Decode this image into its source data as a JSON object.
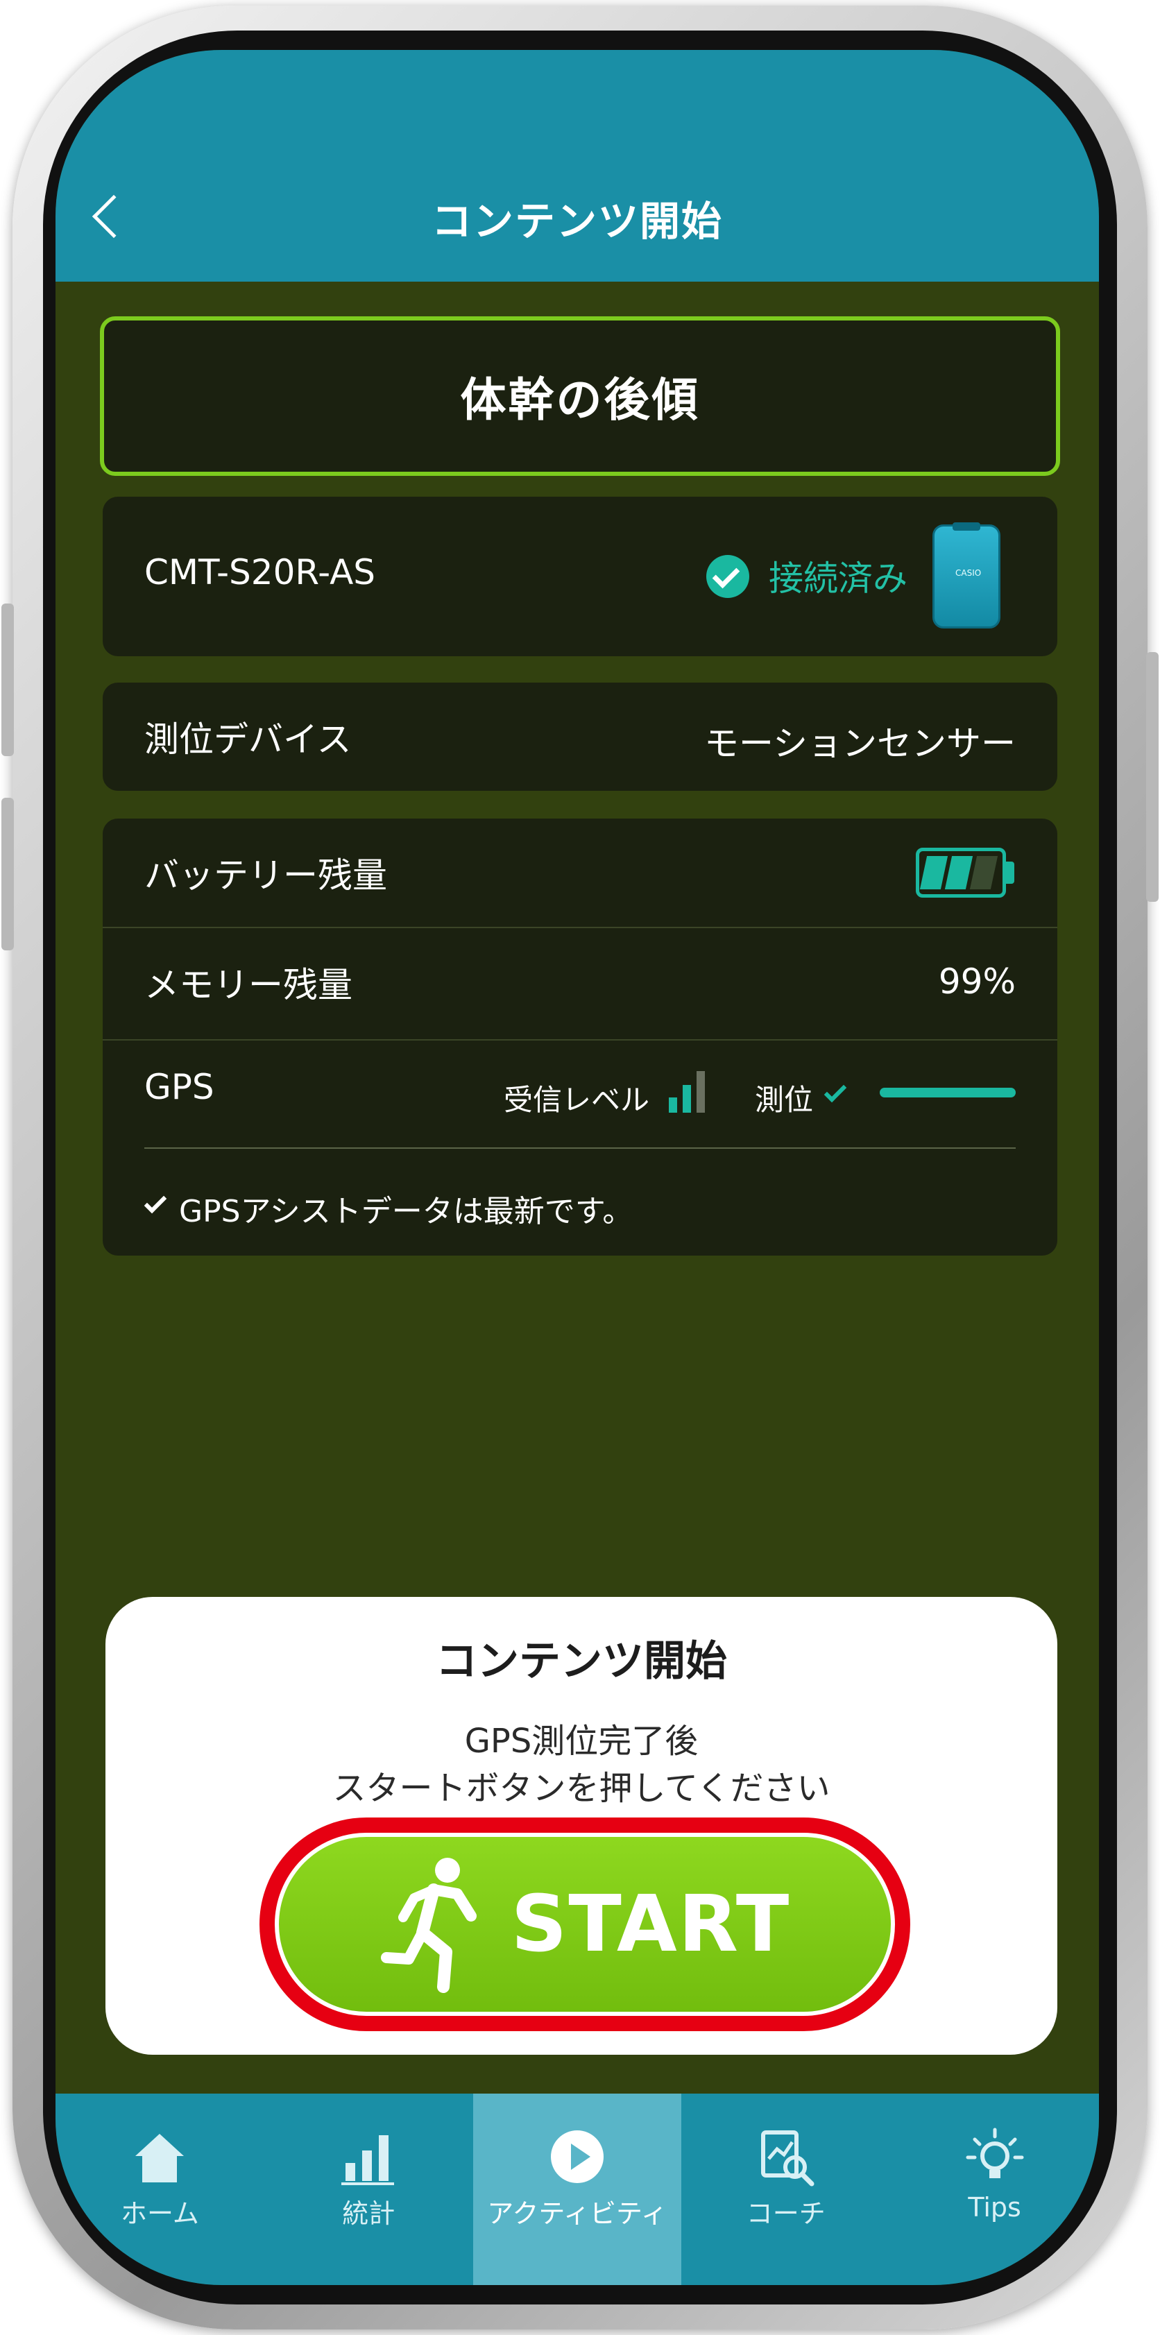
{
  "header": {
    "title": "コンテンツ開始"
  },
  "content": {
    "title": "体幹の後傾",
    "device": {
      "name": "CMT-S20R-AS",
      "status": "接続済み"
    },
    "positioning_device": {
      "label": "測位デバイス",
      "value": "モーションセンサー"
    },
    "battery": {
      "label": "バッテリー残量",
      "level_bars": 2,
      "total_bars": 3
    },
    "memory": {
      "label": "メモリー残量",
      "value": "99%"
    },
    "gps": {
      "label": "GPS",
      "reception_label": "受信レベル",
      "signal_bars": 2,
      "positioning_label": "測位",
      "assist_message": "GPSアシストデータは最新です。"
    }
  },
  "start_panel": {
    "title": "コンテンツ開始",
    "line1": "GPS測位完了後",
    "line2": "スタートボタンを押してください",
    "button_label": "START"
  },
  "tabs": [
    {
      "label": "ホーム",
      "icon": "home-icon",
      "active": false
    },
    {
      "label": "統計",
      "icon": "stats-icon",
      "active": false
    },
    {
      "label": "アクティビティ",
      "icon": "play-icon",
      "active": true
    },
    {
      "label": "コーチ",
      "icon": "coach-icon",
      "active": false
    },
    {
      "label": "Tips",
      "icon": "lightbulb-icon",
      "active": false
    }
  ],
  "colors": {
    "header": "#1a8fa6",
    "background": "#32410f",
    "card": "#1b2110",
    "accent_green": "#7ccb1e",
    "teal": "#1ab8a0",
    "highlight_ring": "#e60012"
  }
}
